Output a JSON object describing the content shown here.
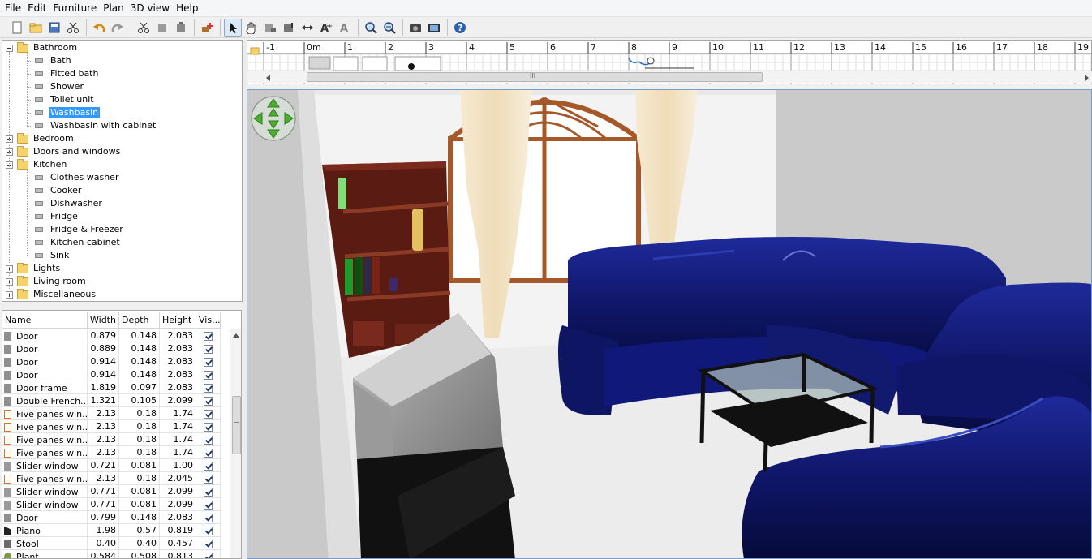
{
  "menu": [
    "File",
    "Edit",
    "Furniture",
    "Plan",
    "3D view",
    "Help"
  ],
  "toolbar": {
    "icons": [
      "new-icon",
      "open-icon",
      "save-icon",
      "cut-icon",
      "undo-icon",
      "redo-icon",
      "cut-icon",
      "copy-icon",
      "paste-icon",
      "add-furniture-icon",
      "select-icon",
      "pan-icon",
      "create-walls-icon",
      "create-rooms-icon",
      "create-dimensions-icon",
      "add-text-icon",
      "text-style-icon",
      "zoom-in-icon",
      "zoom-out-icon",
      "photo-icon",
      "video-icon",
      "help-icon"
    ]
  },
  "catalog": {
    "items": [
      {
        "level": 0,
        "type": "folder",
        "label": "Bathroom",
        "expanded": true
      },
      {
        "level": 1,
        "type": "item",
        "label": "Bath"
      },
      {
        "level": 1,
        "type": "item",
        "label": "Fitted bath"
      },
      {
        "level": 1,
        "type": "item",
        "label": "Shower"
      },
      {
        "level": 1,
        "type": "item",
        "label": "Toilet unit"
      },
      {
        "level": 1,
        "type": "item",
        "label": "Washbasin",
        "selected": true
      },
      {
        "level": 1,
        "type": "item",
        "label": "Washbasin with cabinet"
      },
      {
        "level": 0,
        "type": "folder",
        "label": "Bedroom",
        "expanded": false
      },
      {
        "level": 0,
        "type": "folder",
        "label": "Doors and windows",
        "expanded": false
      },
      {
        "level": 0,
        "type": "folder",
        "label": "Kitchen",
        "expanded": true
      },
      {
        "level": 1,
        "type": "item",
        "label": "Clothes washer"
      },
      {
        "level": 1,
        "type": "item",
        "label": "Cooker"
      },
      {
        "level": 1,
        "type": "item",
        "label": "Dishwasher"
      },
      {
        "level": 1,
        "type": "item",
        "label": "Fridge"
      },
      {
        "level": 1,
        "type": "item",
        "label": "Fridge & Freezer"
      },
      {
        "level": 1,
        "type": "item",
        "label": "Kitchen cabinet"
      },
      {
        "level": 1,
        "type": "item",
        "label": "Sink"
      },
      {
        "level": 0,
        "type": "folder",
        "label": "Lights",
        "expanded": false
      },
      {
        "level": 0,
        "type": "folder",
        "label": "Living room",
        "expanded": false
      },
      {
        "level": 0,
        "type": "folder",
        "label": "Miscellaneous",
        "expanded": false
      }
    ]
  },
  "furniture": {
    "columns": [
      "Name",
      "Width",
      "Depth",
      "Height",
      "Vis..."
    ],
    "rows": [
      {
        "icon": "door",
        "name": "Door",
        "width": "0.879",
        "depth": "0.148",
        "height": "2.083",
        "visible": true
      },
      {
        "icon": "door",
        "name": "Door",
        "width": "0.889",
        "depth": "0.148",
        "height": "2.083",
        "visible": true
      },
      {
        "icon": "door",
        "name": "Door",
        "width": "0.914",
        "depth": "0.148",
        "height": "2.083",
        "visible": true
      },
      {
        "icon": "door",
        "name": "Door",
        "width": "0.914",
        "depth": "0.148",
        "height": "2.083",
        "visible": true
      },
      {
        "icon": "door",
        "name": "Door frame",
        "width": "1.819",
        "depth": "0.097",
        "height": "2.083",
        "visible": true
      },
      {
        "icon": "door",
        "name": "Double French...",
        "width": "1.321",
        "depth": "0.105",
        "height": "2.099",
        "visible": true
      },
      {
        "icon": "window",
        "name": "Five panes win...",
        "width": "2.13",
        "depth": "0.18",
        "height": "1.74",
        "visible": true
      },
      {
        "icon": "window",
        "name": "Five panes win...",
        "width": "2.13",
        "depth": "0.18",
        "height": "1.74",
        "visible": true
      },
      {
        "icon": "window",
        "name": "Five panes win...",
        "width": "2.13",
        "depth": "0.18",
        "height": "1.74",
        "visible": true
      },
      {
        "icon": "window",
        "name": "Five panes win...",
        "width": "2.13",
        "depth": "0.18",
        "height": "1.74",
        "visible": true
      },
      {
        "icon": "slider",
        "name": "Slider window",
        "width": "0.721",
        "depth": "0.081",
        "height": "1.00",
        "visible": true
      },
      {
        "icon": "window",
        "name": "Five panes win...",
        "width": "2.13",
        "depth": "0.18",
        "height": "2.045",
        "visible": true
      },
      {
        "icon": "slider",
        "name": "Slider window",
        "width": "0.771",
        "depth": "0.081",
        "height": "2.099",
        "visible": true
      },
      {
        "icon": "slider",
        "name": "Slider window",
        "width": "0.771",
        "depth": "0.081",
        "height": "2.099",
        "visible": true
      },
      {
        "icon": "door",
        "name": "Door",
        "width": "0.799",
        "depth": "0.148",
        "height": "2.083",
        "visible": true
      },
      {
        "icon": "piano",
        "name": "Piano",
        "width": "1.98",
        "depth": "0.57",
        "height": "0.819",
        "visible": true
      },
      {
        "icon": "stool",
        "name": "Stool",
        "width": "0.40",
        "depth": "0.40",
        "height": "0.457",
        "visible": true
      },
      {
        "icon": "plant",
        "name": "Plant",
        "width": "0.584",
        "depth": "0.508",
        "height": "0.813",
        "visible": true
      }
    ]
  },
  "plan": {
    "ruler_labels": [
      "-1",
      "0m",
      "1",
      "2",
      "3",
      "4",
      "5",
      "6",
      "7",
      "8",
      "9",
      "10",
      "11",
      "12",
      "13",
      "14",
      "15",
      "16",
      "17",
      "18",
      "19"
    ],
    "scroll_grip": "III"
  },
  "view3d": {
    "navigator": "navigation-arrows-icon"
  }
}
